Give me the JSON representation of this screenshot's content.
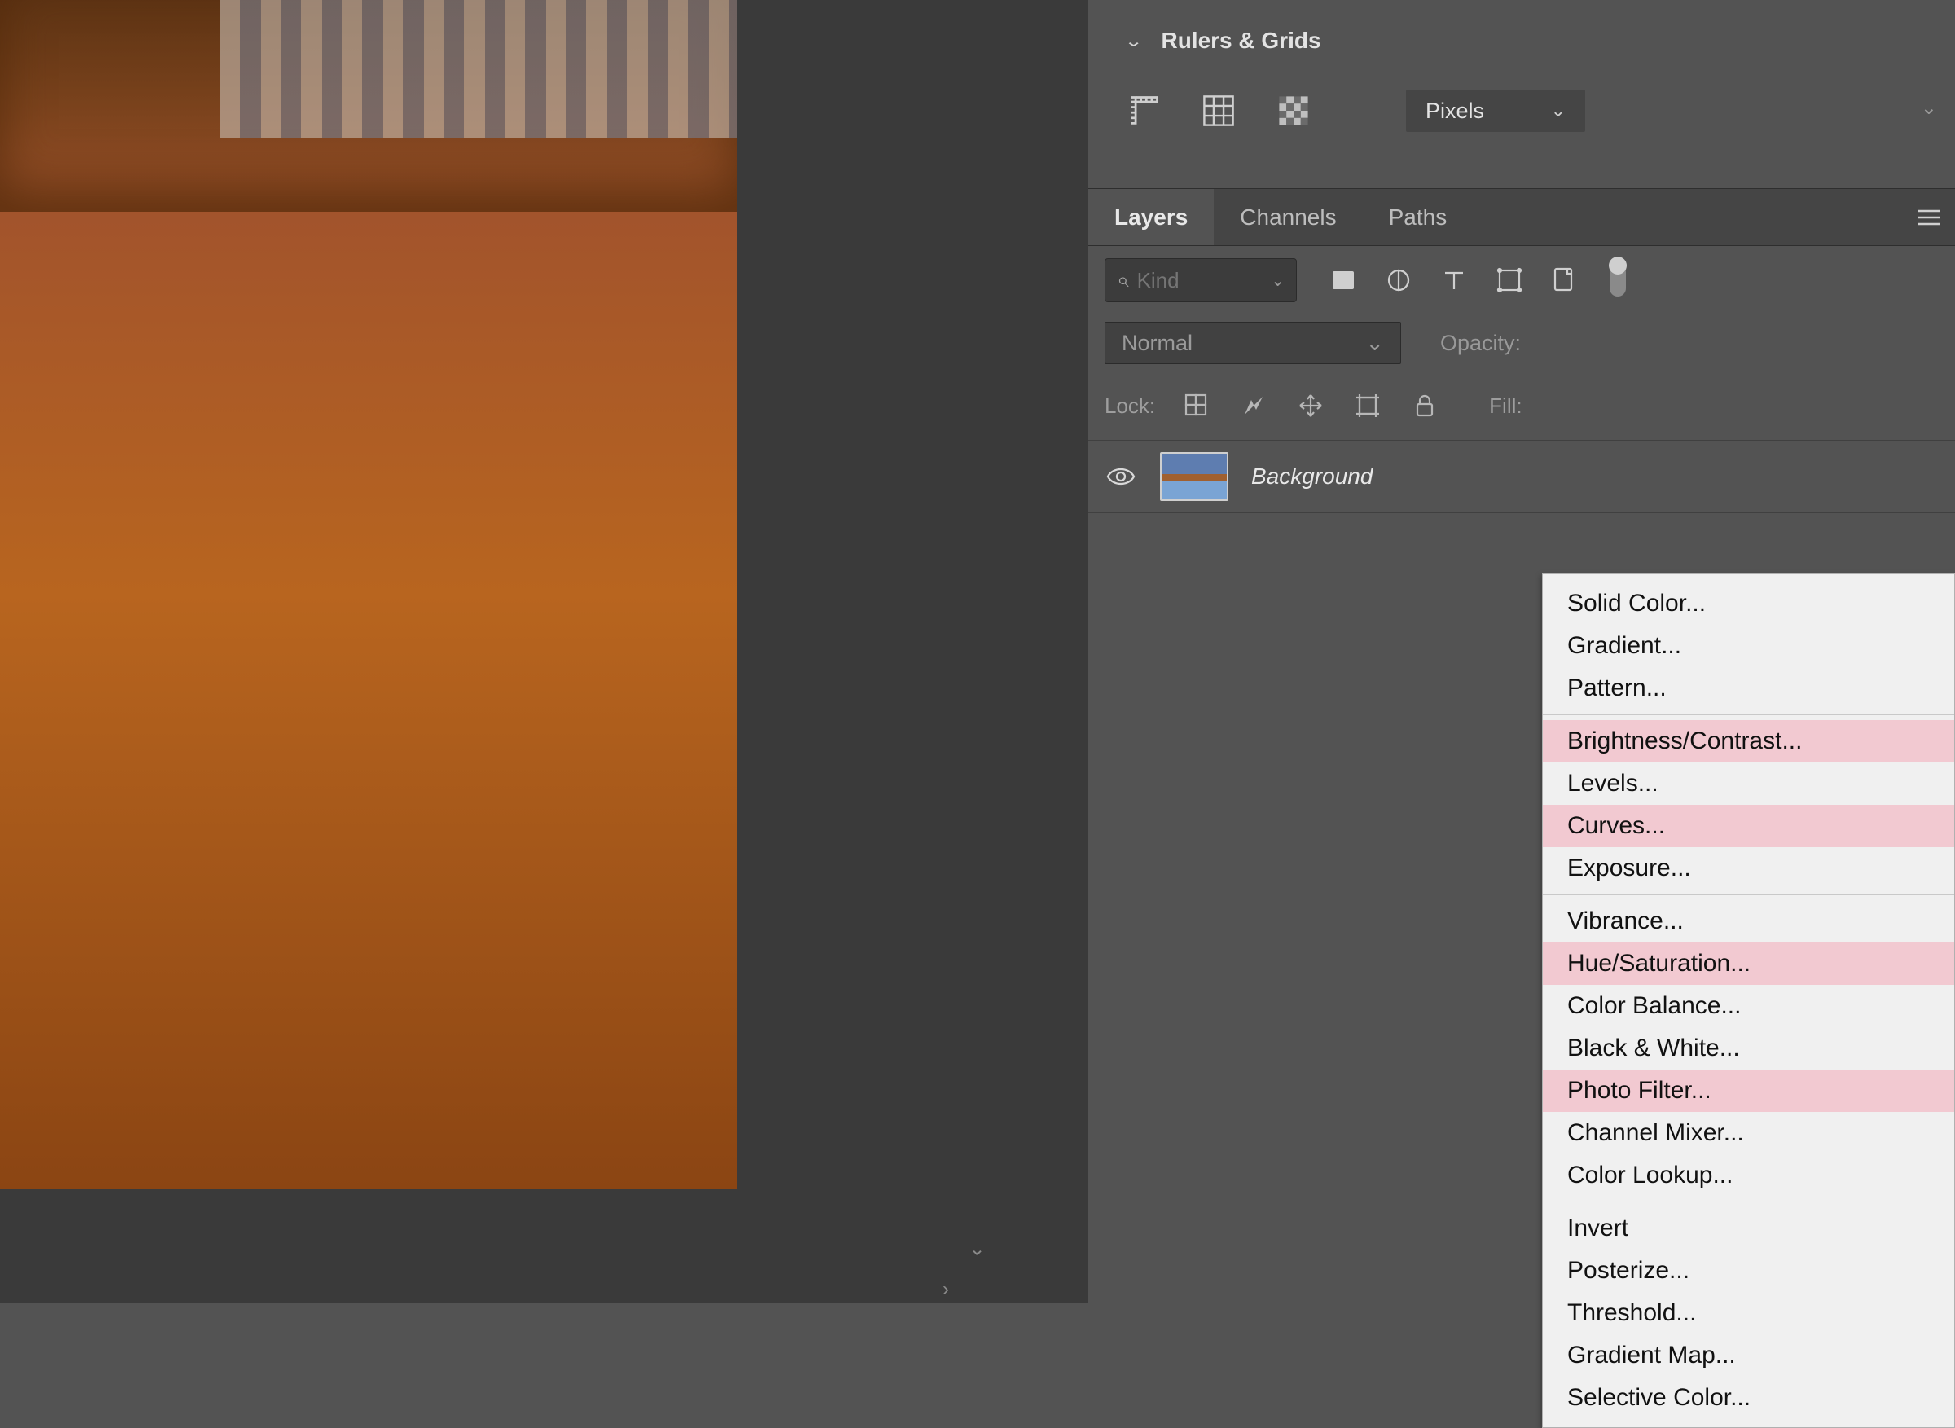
{
  "rulers_panel": {
    "title": "Rulers & Grids",
    "unit": "Pixels"
  },
  "layers_panel": {
    "tabs": [
      "Layers",
      "Channels",
      "Paths"
    ],
    "active_tab": 0,
    "filter_placeholder": "Kind",
    "blend_mode": "Normal",
    "opacity_label": "Opacity:",
    "lock_label": "Lock:",
    "fill_label": "Fill:",
    "layer": {
      "name": "Background"
    }
  },
  "context_menu": {
    "groups": [
      [
        {
          "label": "Solid Color...",
          "highlight": false
        },
        {
          "label": "Gradient...",
          "highlight": false
        },
        {
          "label": "Pattern...",
          "highlight": false
        }
      ],
      [
        {
          "label": "Brightness/Contrast...",
          "highlight": true
        },
        {
          "label": "Levels...",
          "highlight": false
        },
        {
          "label": "Curves...",
          "highlight": true
        },
        {
          "label": "Exposure...",
          "highlight": false
        }
      ],
      [
        {
          "label": "Vibrance...",
          "highlight": false
        },
        {
          "label": "Hue/Saturation...",
          "highlight": true
        },
        {
          "label": "Color Balance...",
          "highlight": false
        },
        {
          "label": "Black & White...",
          "highlight": false
        },
        {
          "label": "Photo Filter...",
          "highlight": true
        },
        {
          "label": "Channel Mixer...",
          "highlight": false
        },
        {
          "label": "Color Lookup...",
          "highlight": false
        }
      ],
      [
        {
          "label": "Invert",
          "highlight": false
        },
        {
          "label": "Posterize...",
          "highlight": false
        },
        {
          "label": "Threshold...",
          "highlight": false
        },
        {
          "label": "Gradient Map...",
          "highlight": false
        },
        {
          "label": "Selective Color...",
          "highlight": false
        }
      ]
    ]
  }
}
